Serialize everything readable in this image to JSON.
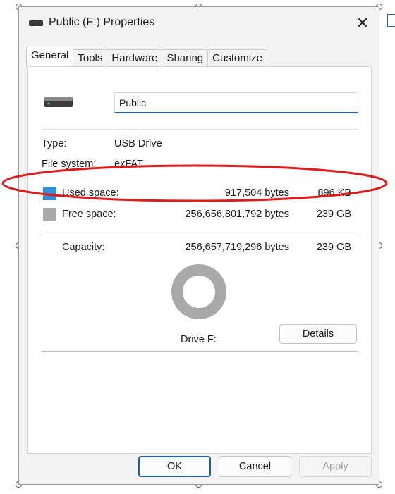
{
  "window": {
    "title": "Public (F:) Properties",
    "close_glyph": "✕"
  },
  "tabs": [
    {
      "label": "General",
      "active": true
    },
    {
      "label": "Tools",
      "active": false
    },
    {
      "label": "Hardware",
      "active": false
    },
    {
      "label": "Sharing",
      "active": false
    },
    {
      "label": "Customize",
      "active": false
    }
  ],
  "general": {
    "drive_name_value": "Public",
    "type_label": "Type:",
    "type_value": "USB Drive",
    "filesystem_label": "File system:",
    "filesystem_value": "exFAT",
    "used_label": "Used space:",
    "used_bytes": "917,504 bytes",
    "used_size": "896 KB",
    "free_label": "Free space:",
    "free_bytes": "256,656,801,792 bytes",
    "free_size": "239 GB",
    "capacity_label": "Capacity:",
    "capacity_bytes": "256,657,719,296 bytes",
    "capacity_size": "239 GB",
    "drive_caption": "Drive F:",
    "details_label": "Details",
    "used_fraction": 3.6e-06
  },
  "buttons": {
    "ok": "OK",
    "cancel": "Cancel",
    "apply": "Apply"
  },
  "colors": {
    "used": "#2f8fd8",
    "free": "#a9a9a9",
    "highlight": "#e01b1b",
    "accent": "#1b5fb4"
  },
  "icons": {
    "title": "drive-icon",
    "close": "close-icon",
    "drive": "usb-drive-icon"
  }
}
